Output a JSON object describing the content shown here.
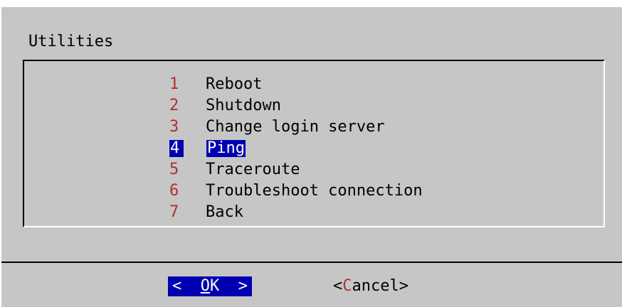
{
  "dialog": {
    "title": "Utilities",
    "menu": [
      {
        "num": "1",
        "label": "Reboot"
      },
      {
        "num": "2",
        "label": "Shutdown"
      },
      {
        "num": "3",
        "label": "Change login server"
      },
      {
        "num": "4",
        "label": "Ping",
        "selected": true
      },
      {
        "num": "5",
        "label": "Traceroute"
      },
      {
        "num": "6",
        "label": "Troubleshoot connection"
      },
      {
        "num": "7",
        "label": "Back"
      }
    ],
    "buttons": {
      "ok": {
        "left": "<  ",
        "hotkey": "O",
        "rest": "K  >"
      },
      "cancel": {
        "left": "<",
        "hotkey": "C",
        "rest": "ancel>"
      }
    }
  },
  "colors": {
    "background": "#c6c6c6",
    "highlight": "#0000b2",
    "hotkey": "#b2302a"
  }
}
